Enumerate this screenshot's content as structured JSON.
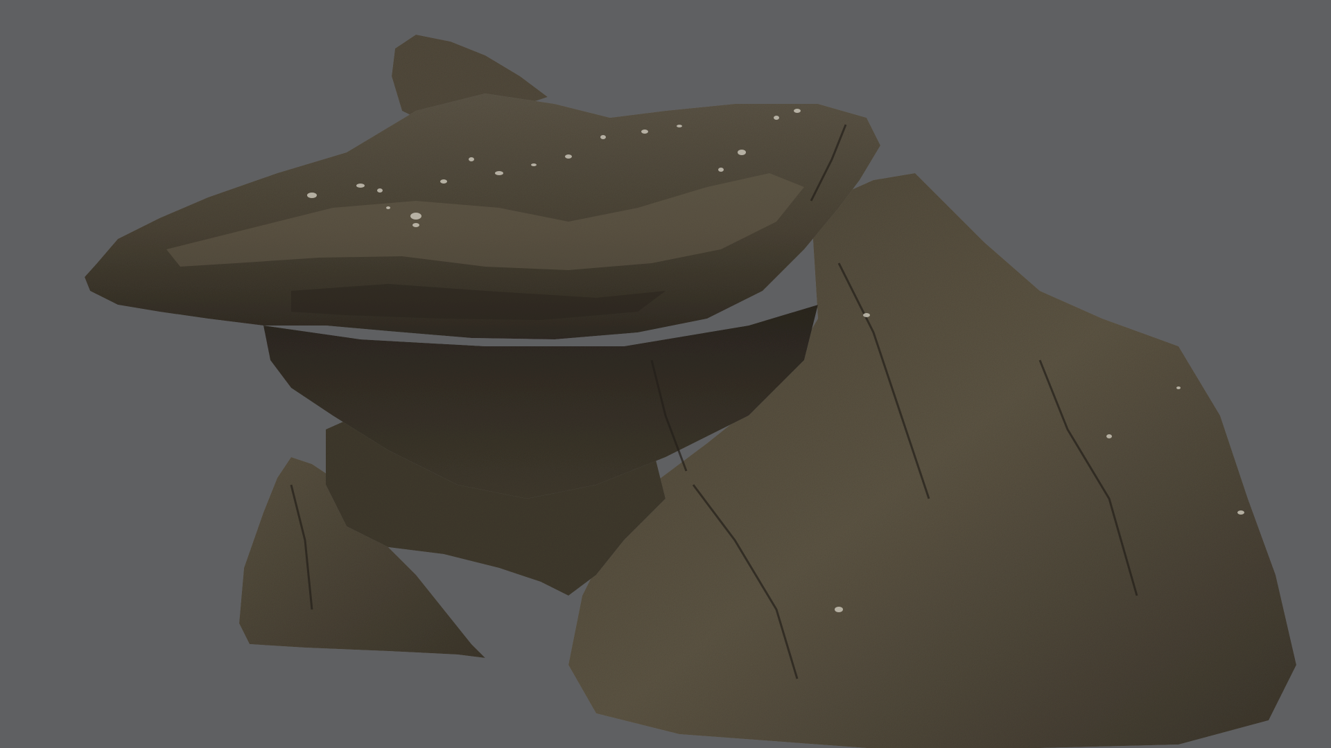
{
  "scene": {
    "subject": "rock-formation",
    "background_color": "#5f6062",
    "rock_colors": {
      "base": "#4a4335",
      "dark": "#2f2a22",
      "mid": "#5a5141",
      "light": "#7a705c",
      "highlight": "#9a917c",
      "lichen": "#cfcabd"
    }
  }
}
